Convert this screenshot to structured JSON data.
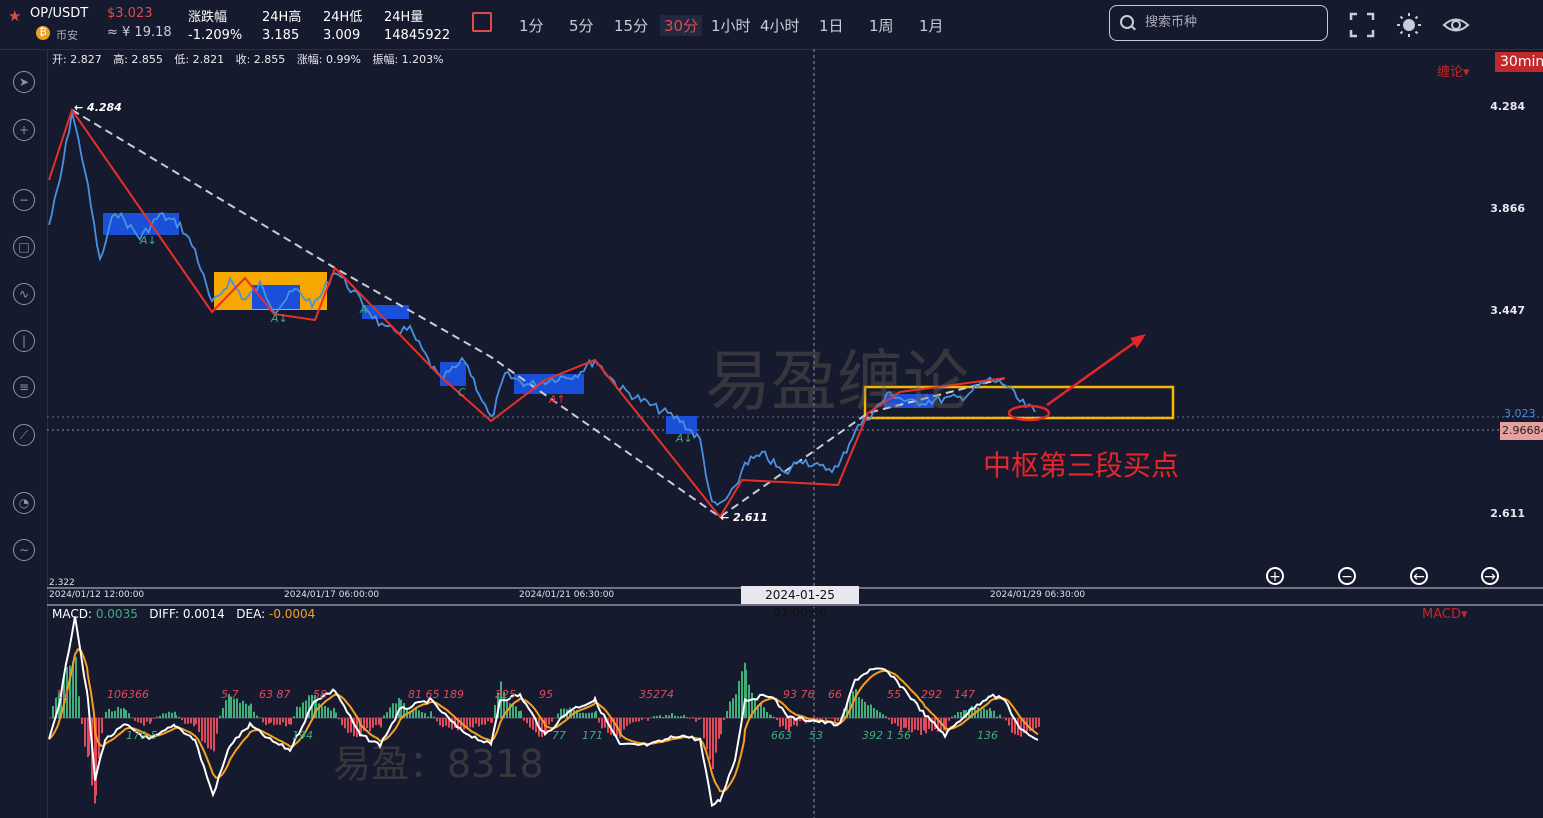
{
  "header": {
    "pair": "OP/USDT",
    "price": "$3.023",
    "exchange": "币安",
    "cny": "≈ ¥ 19.18",
    "stats": [
      {
        "label": "涨跌幅",
        "value": "-1.209%"
      },
      {
        "label": "24H高",
        "value": "3.185"
      },
      {
        "label": "24H低",
        "value": "3.009"
      },
      {
        "label": "24H量",
        "value": "14845922"
      }
    ],
    "timeframes": [
      "1分",
      "5分",
      "15分",
      "30分",
      "1小时",
      "4小时",
      "1日",
      "1周",
      "1月"
    ],
    "active_timeframe": "30分",
    "search_placeholder": "搜索币种"
  },
  "ohlc_bar": {
    "open": "开: 2.827",
    "high": "高: 2.855",
    "low": "低: 2.821",
    "close": "收: 2.855",
    "change": "涨幅: 0.99%",
    "amplitude": "振幅: 1.203%"
  },
  "chart_badge": "30min",
  "indicator_menu": "缠论",
  "macd_menu": "MACD",
  "price_axis": [
    "4.284",
    "3.866",
    "3.447",
    "3.023",
    "2.611"
  ],
  "price_last": "3.023",
  "price_current": "2.966840",
  "low_price_label": "2.322",
  "date_labels": [
    "2024/01/12 12:00:00",
    "2024/01/17 06:00:00",
    "2024/01/21 06:30:00",
    "2024/01/29 06:30:00"
  ],
  "crosshair_date": "2024-01-25 07:00:00",
  "macd_legend": {
    "macd_label": "MACD:",
    "macd_value": "0.0035",
    "diff_label": "DIFF:",
    "diff_value": "0.0014",
    "dea_label": "DEA:",
    "dea_value": "-0.0004"
  },
  "annotation": "中枢第三段买点",
  "watermark_main": "易盈缠论",
  "watermark_sub": "易盈：8318",
  "chart_labels": {
    "high_label": "← 4.284",
    "low_label": "← 2.611"
  },
  "colors": {
    "bg": "#161a2e",
    "accent": "#e04a4a",
    "up": "#3fae7a",
    "down": "#e04a5a",
    "pivot_yellow": "#f5a800",
    "pivot_blue": "#1a4fd8"
  },
  "chart_data": {
    "type": "line",
    "title": "",
    "xlabel": "",
    "ylabel": "",
    "ylim": [
      2.322,
      4.5
    ],
    "pen_points": [
      {
        "x": "2024/01/12 12:00",
        "y": 4.284
      },
      {
        "x": "2024/01/14",
        "y": 3.45
      },
      {
        "x": "2024/01/15",
        "y": 3.62
      },
      {
        "x": "2024/01/17 06:00",
        "y": 3.45
      },
      {
        "x": "2024/01/18",
        "y": 3.62
      },
      {
        "x": "2024/01/20",
        "y": 3.0
      },
      {
        "x": "2024/01/21 06:30",
        "y": 3.17
      },
      {
        "x": "2024/01/25 07:00",
        "y": 2.611
      },
      {
        "x": "2024/01/26",
        "y": 2.85
      },
      {
        "x": "2024/01/27",
        "y": 2.72
      },
      {
        "x": "2024/01/28",
        "y": 3.17
      },
      {
        "x": "2024/01/29 06:30",
        "y": 3.05
      }
    ]
  }
}
